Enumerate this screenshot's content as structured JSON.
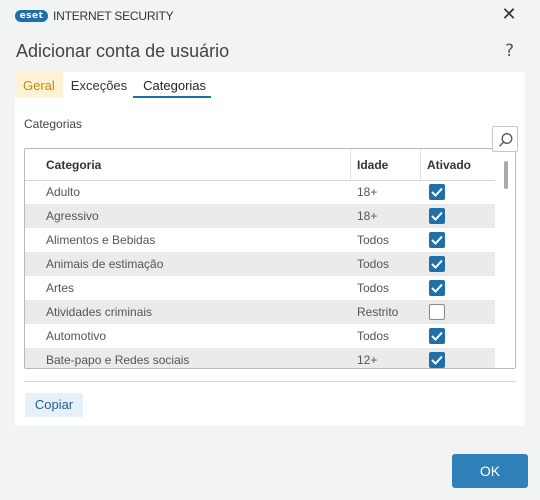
{
  "window": {
    "logo_text": "eset",
    "product_name": "INTERNET SECURITY",
    "close_icon": "close-icon"
  },
  "dialog": {
    "title": "Adicionar conta de usuário",
    "help_label": "?"
  },
  "tabs": [
    {
      "label": "Geral"
    },
    {
      "label": "Exceções"
    },
    {
      "label": "Categorias"
    }
  ],
  "active_tab": "Categorias",
  "colors": {
    "accent": "#1f6fa8",
    "geral_tab_bg": "#fdf3d4",
    "geral_tab_text": "#c78a00",
    "ok_button": "#2f80b8"
  },
  "categories": {
    "section_label": "Categorias",
    "search_icon": "search-icon",
    "columns": [
      "Categoria",
      "Idade",
      "Ativado"
    ],
    "rows": [
      {
        "name": "Adulto",
        "age": "18+",
        "enabled": true
      },
      {
        "name": "Agressivo",
        "age": "18+",
        "enabled": true
      },
      {
        "name": "Alimentos e Bebidas",
        "age": "Todos",
        "enabled": true
      },
      {
        "name": "Animais de estimação",
        "age": "Todos",
        "enabled": true
      },
      {
        "name": "Artes",
        "age": "Todos",
        "enabled": true
      },
      {
        "name": "Atividades criminais",
        "age": "Restrito",
        "enabled": false
      },
      {
        "name": "Automotivo",
        "age": "Todos",
        "enabled": true
      },
      {
        "name": "Bate-papo e Redes sociais",
        "age": "12+",
        "enabled": true
      }
    ]
  },
  "actions": {
    "copy_label": "Copiar",
    "ok_label": "OK"
  }
}
